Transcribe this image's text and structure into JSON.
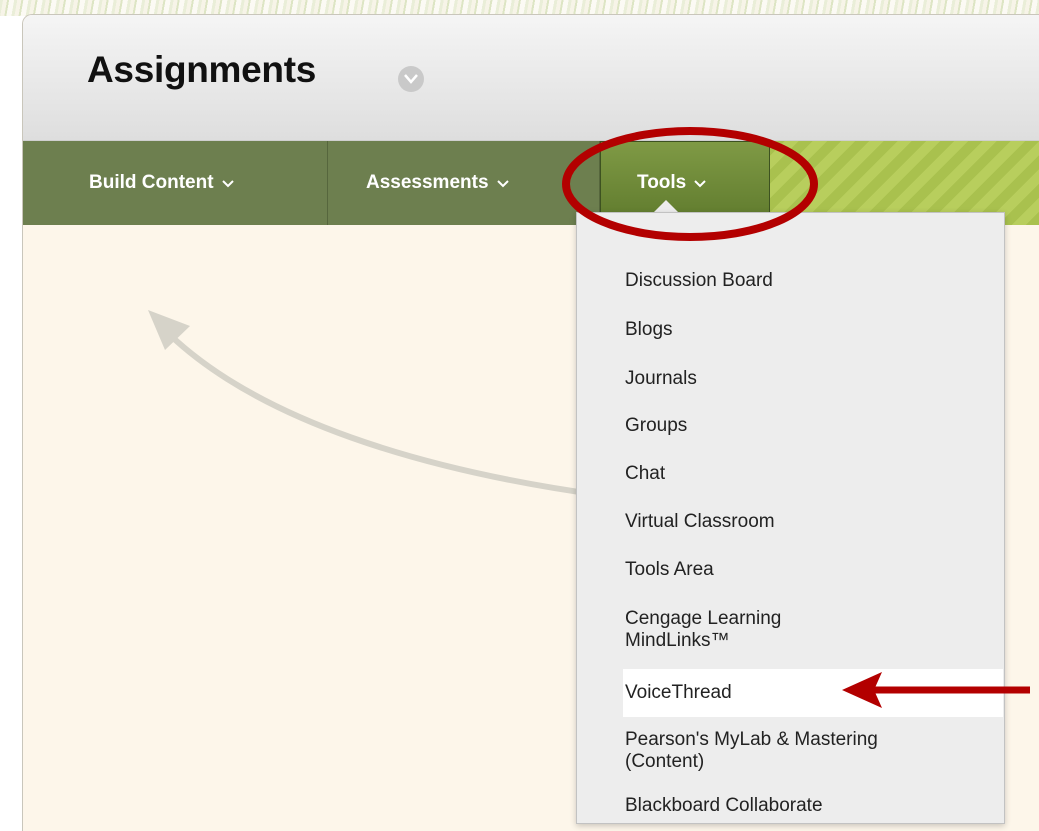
{
  "header": {
    "title": "Assignments"
  },
  "toolbar": {
    "build_content": "Build Content",
    "assessments": "Assessments",
    "tools": "Tools"
  },
  "tools_menu": {
    "items": [
      "Discussion Board",
      "Blogs",
      "Journals",
      "Groups",
      "Chat",
      "Virtual Classroom",
      "Tools Area",
      "Cengage Learning MindLinks™",
      "VoiceThread",
      "Pearson's MyLab & Mastering (Content)",
      "Blackboard Collaborate"
    ],
    "highlighted_item": "VoiceThread"
  },
  "colors": {
    "toolbar_base": "#6d7f4f",
    "toolbar_stripes": "#a9c14e",
    "annotation_red": "#b30000",
    "content_bg": "#fdf6ea"
  },
  "icons": [
    "chevron-down-icon",
    "title-options-icon",
    "curved-arrow-icon",
    "annotation-arrow-icon"
  ]
}
